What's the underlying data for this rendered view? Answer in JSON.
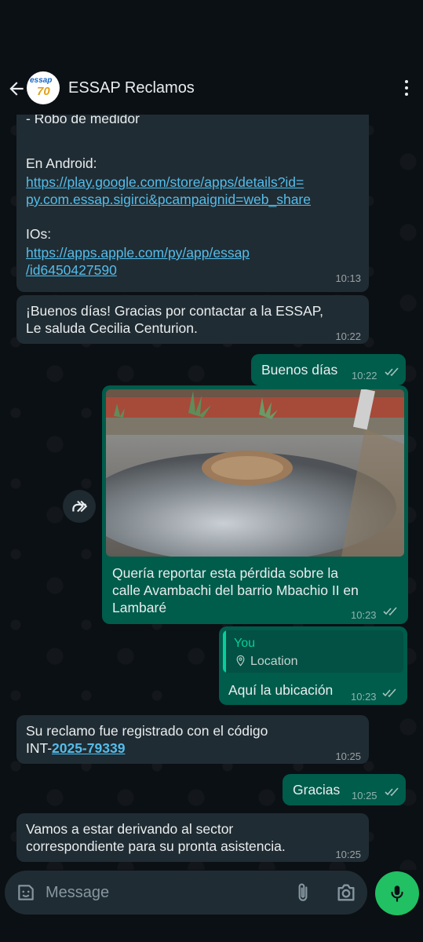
{
  "header": {
    "title": "ESSAP Reclamos",
    "avatar_text_top": "essap",
    "avatar_text_bottom": "70"
  },
  "messages": {
    "m1": {
      "line1": "- Robo de medidor",
      "android_label": "En Android:",
      "android_link_1": "https://play.google.com/store/apps/details?id=",
      "android_link_2": "py.com.essap.sigirci&pcampaignid=web_share",
      "ios_label": "IOs:",
      "ios_link_1": "https://apps.apple.com/py/app/essap",
      "ios_link_2": "/id6450427590",
      "time": "10:13"
    },
    "m2": {
      "line1": "¡Buenos días! Gracias por contactar a la ESSAP,",
      "line2": "Le saluda Cecilia Centurion.",
      "time": "10:22"
    },
    "m3": {
      "text": "Buenos días",
      "time": "10:22"
    },
    "m4": {
      "line1": "Quería reportar esta pérdida sobre la",
      "line2": "calle Avambachi del barrio Mbachio II en",
      "line3": "Lambaré",
      "time": "10:23"
    },
    "m5": {
      "quote_author": "You",
      "quote_text": "Location",
      "text": "Aquí la ubicación",
      "time": "10:23"
    },
    "m6": {
      "line1": "Su reclamo fue registrado con el código",
      "code_prefix": "INT-",
      "code_link": "2025-79339",
      "time": "10:25"
    },
    "m7": {
      "text": "Gracias",
      "time": "10:25"
    },
    "m8": {
      "line1": "Vamos a estar derivando al sector",
      "line2": "correspondiente para su pronta asistencia.",
      "time": "10:25"
    }
  },
  "composer": {
    "placeholder": "Message"
  },
  "icons": {
    "back": "arrow-left-icon",
    "menu": "more-vertical-icon",
    "forward": "forward-icon",
    "sticker": "sticker-icon",
    "attach": "paperclip-icon",
    "camera": "camera-icon",
    "mic": "microphone-icon",
    "read": "double-check-icon"
  },
  "colors": {
    "background": "#0b1014",
    "incoming": "#202c33",
    "outgoing": "#005c4b",
    "link": "#53bdeb",
    "mic_button": "#21c063"
  }
}
